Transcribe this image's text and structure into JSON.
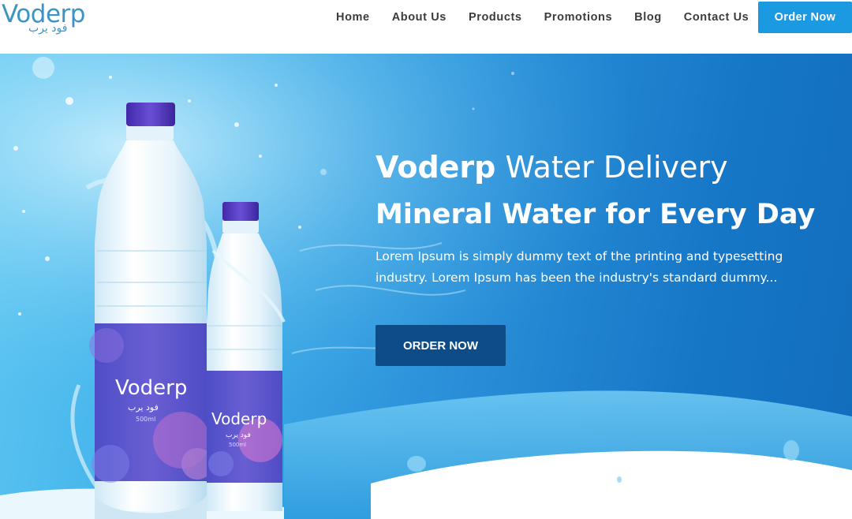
{
  "header": {
    "logo": {
      "wordmark": "Voderp",
      "arabic": "فود يرب"
    },
    "nav": [
      {
        "label": "Home"
      },
      {
        "label": "About Us"
      },
      {
        "label": "Products"
      },
      {
        "label": "Promotions"
      },
      {
        "label": "Blog"
      },
      {
        "label": "Contact Us"
      }
    ],
    "order_button": "Order Now"
  },
  "hero": {
    "title_brand": "Voderp",
    "title_rest": " Water Delivery",
    "subtitle": "Mineral Water for Every Day",
    "description": "Lorem Ipsum is simply dummy text of the printing and typesetting industry. Lorem Ipsum has been the industry's standard dummy...",
    "cta": "ORDER NOW",
    "bottle_label": {
      "brand": "Voderp",
      "arabic": "فود يرب",
      "volume": "500ml"
    }
  },
  "colors": {
    "accent": "#1b9ae2",
    "cta_dark": "#0d4c86",
    "logo": "#3a94c4",
    "bottle_cap": "#5a3fc0",
    "label_purple": "#5a55c9"
  }
}
